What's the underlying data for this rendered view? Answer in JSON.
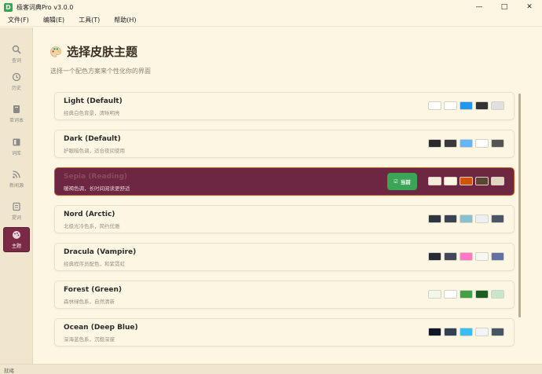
{
  "window": {
    "title": "极客词典Pro v3.0.0",
    "app_icon_letter": "D"
  },
  "window_controls": {
    "minimize": "—",
    "maximize": "□",
    "close": "✕"
  },
  "menu": [
    "文件(F)",
    "编辑(E)",
    "工具(T)",
    "帮助(H)"
  ],
  "sidebar": {
    "items": [
      {
        "label": "查词",
        "icon": "search-icon"
      },
      {
        "label": "历史",
        "icon": "history-icon"
      },
      {
        "label": "单词本",
        "icon": "book-icon"
      },
      {
        "label": "词库",
        "icon": "library-icon"
      },
      {
        "label": "新闻源",
        "icon": "rss-icon"
      },
      {
        "label": "提词",
        "icon": "note-icon"
      },
      {
        "label": "主题",
        "icon": "palette-icon",
        "active": true
      }
    ]
  },
  "page": {
    "title": "选择皮肤主题",
    "subtitle": "选择一个配色方案来个性化你的界面"
  },
  "themes": [
    {
      "name": "Light (Default)",
      "desc": "经典白色背景，清晰明亮",
      "swatches": [
        "#ffffff",
        "#ffffff",
        "#2196f3",
        "#333333",
        "#e0e0e0"
      ]
    },
    {
      "name": "Dark (Default)",
      "desc": "护眼暗色调，适合夜间使用",
      "swatches": [
        "#2b2b2b",
        "#3a3a3a",
        "#64b5f6",
        "#ffffff",
        "#555555"
      ]
    },
    {
      "name": "Sepia (Reading)",
      "desc": "暖褐色调，长时间阅读更舒适",
      "swatches": [
        "#f4ecd8",
        "#fdf6e3",
        "#d35400",
        "#5b4636",
        "#e0d6c0"
      ],
      "selected": true,
      "badge": "当前",
      "badge_check": "☑"
    },
    {
      "name": "Nord (Arctic)",
      "desc": "北极光冷色系，简约优雅",
      "swatches": [
        "#2e3440",
        "#3b4252",
        "#88c0d0",
        "#eceff4",
        "#4c566a"
      ]
    },
    {
      "name": "Dracula (Vampire)",
      "desc": "经典程序员配色，和紫霓虹",
      "swatches": [
        "#282a36",
        "#44475a",
        "#ff79c6",
        "#f8f8f2",
        "#6272a4"
      ]
    },
    {
      "name": "Forest (Green)",
      "desc": "森林绿色系，自然清新",
      "swatches": [
        "#f1f8e9",
        "#ffffff",
        "#43a047",
        "#1b5e20",
        "#c8e6c9"
      ]
    },
    {
      "name": "Ocean (Deep Blue)",
      "desc": "深海蓝色系，沉稳深邃",
      "swatches": [
        "#0f172a",
        "#334155",
        "#38bdf8",
        "#f1f5f9",
        "#475569"
      ]
    }
  ],
  "status": {
    "text": "就绪"
  }
}
